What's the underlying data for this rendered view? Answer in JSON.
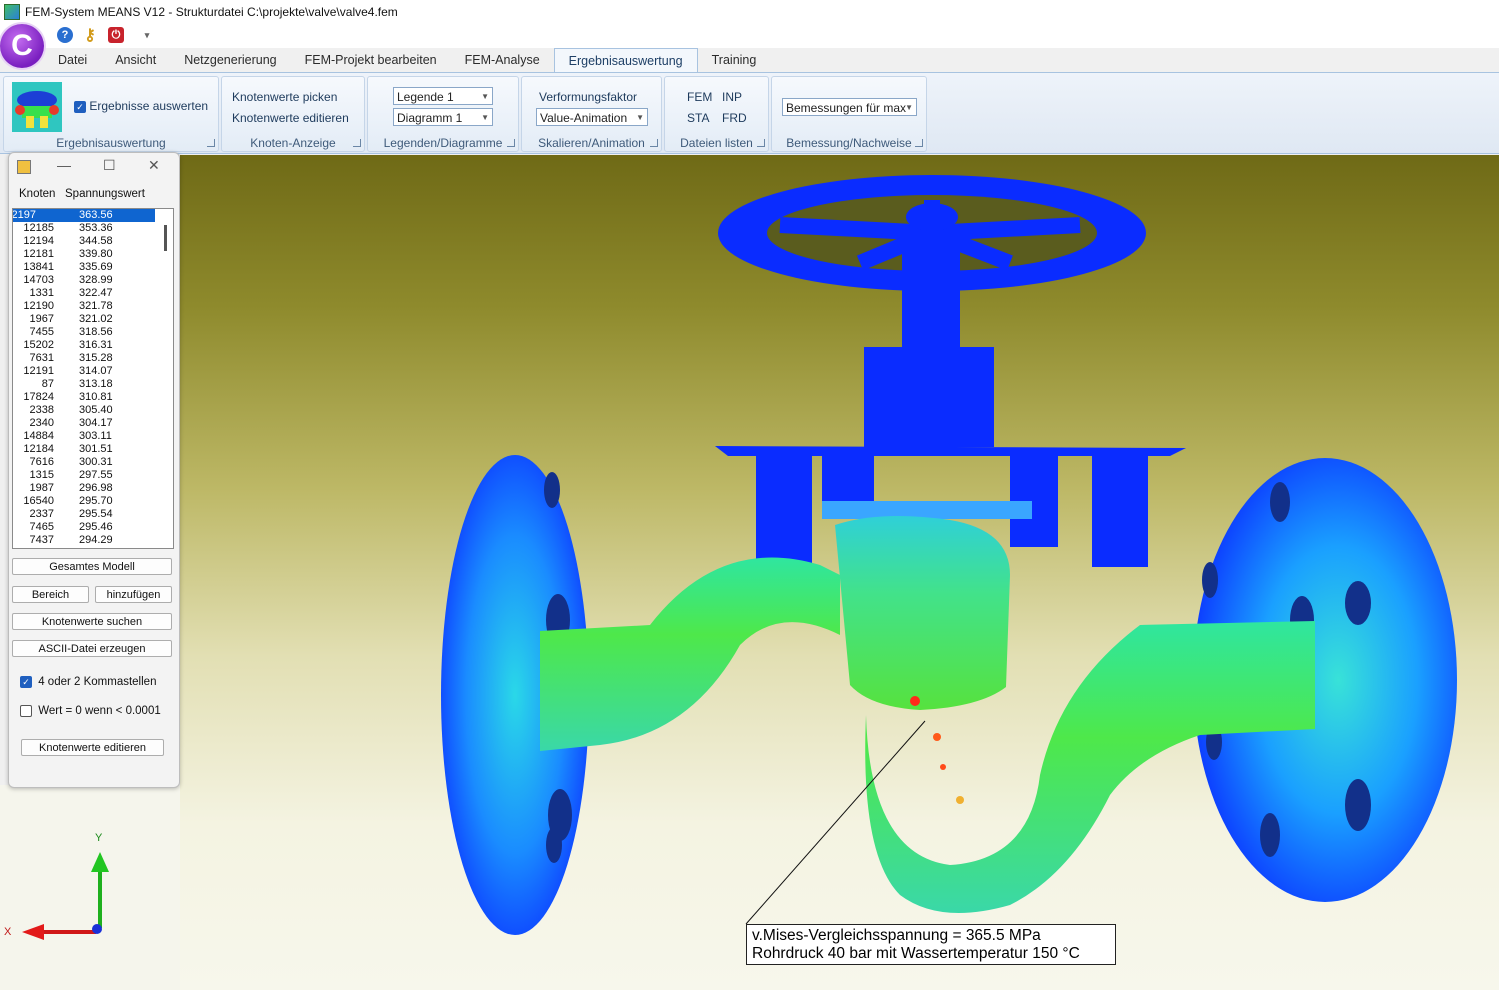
{
  "window": {
    "title": "FEM-System MEANS V12 - Strukturdatei C:\\projekte\\valve\\valve4.fem"
  },
  "app_logo": {
    "letter": "C",
    "color": "#8a2be2"
  },
  "quick_access": {
    "icons": [
      "help-icon",
      "key-icon",
      "power-icon",
      "dropdown-arrow-icon"
    ],
    "help_glyph": "?",
    "key_glyph": "⚷",
    "power_glyph": "⏻",
    "arrow_glyph": "▾"
  },
  "tabs": [
    "Datei",
    "Ansicht",
    "Netzgenerierung",
    "FEM-Projekt bearbeiten",
    "FEM-Analyse",
    "Ergebnisauswertung",
    "Training"
  ],
  "active_tab": "Ergebnisauswertung",
  "ribbon": {
    "ergebnis": {
      "checkbox_label": "Ergebnisse auswerten",
      "checked": true,
      "group_label": "Ergebnisauswertung"
    },
    "knoten": {
      "pick": "Knotenwerte picken",
      "edit": "Knotenwerte editieren",
      "group_label": "Knoten-Anzeige"
    },
    "legenden": {
      "legend_combo": "Legende 1",
      "diagram_combo": "Diagramm 1",
      "group_label": "Legenden/Diagramme"
    },
    "skalieren": {
      "label": "Verformungsfaktor",
      "anim_combo": "Value-Animation",
      "group_label": "Skalieren/Animation"
    },
    "dateien": {
      "fem": "FEM",
      "inp": "INP",
      "sta": "STA",
      "frd": "FRD",
      "group_label": "Dateien listen"
    },
    "bemessung": {
      "combo": "Bemessungen für max",
      "group_label": "Bemessung/Nachweise"
    }
  },
  "panel": {
    "col_knoten": "Knoten",
    "col_wert": "Spannungswert",
    "rows": [
      [
        "12197",
        "363.56"
      ],
      [
        "12185",
        "353.36"
      ],
      [
        "12194",
        "344.58"
      ],
      [
        "12181",
        "339.80"
      ],
      [
        "13841",
        "335.69"
      ],
      [
        "14703",
        "328.99"
      ],
      [
        "1331",
        "322.47"
      ],
      [
        "12190",
        "321.78"
      ],
      [
        "1967",
        "321.02"
      ],
      [
        "7455",
        "318.56"
      ],
      [
        "15202",
        "316.31"
      ],
      [
        "7631",
        "315.28"
      ],
      [
        "12191",
        "314.07"
      ],
      [
        "87",
        "313.18"
      ],
      [
        "17824",
        "310.81"
      ],
      [
        "2338",
        "305.40"
      ],
      [
        "2340",
        "304.17"
      ],
      [
        "14884",
        "303.11"
      ],
      [
        "12184",
        "301.51"
      ],
      [
        "7616",
        "300.31"
      ],
      [
        "1315",
        "297.55"
      ],
      [
        "1987",
        "296.98"
      ],
      [
        "16540",
        "295.70"
      ],
      [
        "2337",
        "295.54"
      ],
      [
        "7465",
        "295.46"
      ],
      [
        "7437",
        "294.29"
      ]
    ],
    "btn_gesamt": "Gesamtes Modell",
    "btn_bereich": "Bereich",
    "btn_hinzu": "hinzufügen",
    "btn_suchen": "Knotenwerte suchen",
    "btn_ascii": "ASCII-Datei erzeugen",
    "chk_komma": "4 oder 2 Kommastellen",
    "chk_komma_checked": true,
    "chk_wert": "Wert = 0 wenn < 0.0001",
    "chk_wert_checked": false,
    "btn_edit": "Knotenwerte editieren"
  },
  "viewport": {
    "annotation_line1": "v.Mises-Vergleichsspannung = 365.5 MPa",
    "annotation_line2": "Rohrdruck 40 bar mit Wassertemperatur 150 °C",
    "axis_y": "Y",
    "axis_x": "X"
  },
  "colors": {
    "model_blue": "#0a2cff",
    "stress_green": "#35e14a",
    "stress_yellow": "#f0f03a",
    "stress_red": "#ff2a1a",
    "selection": "#0f65d0"
  }
}
